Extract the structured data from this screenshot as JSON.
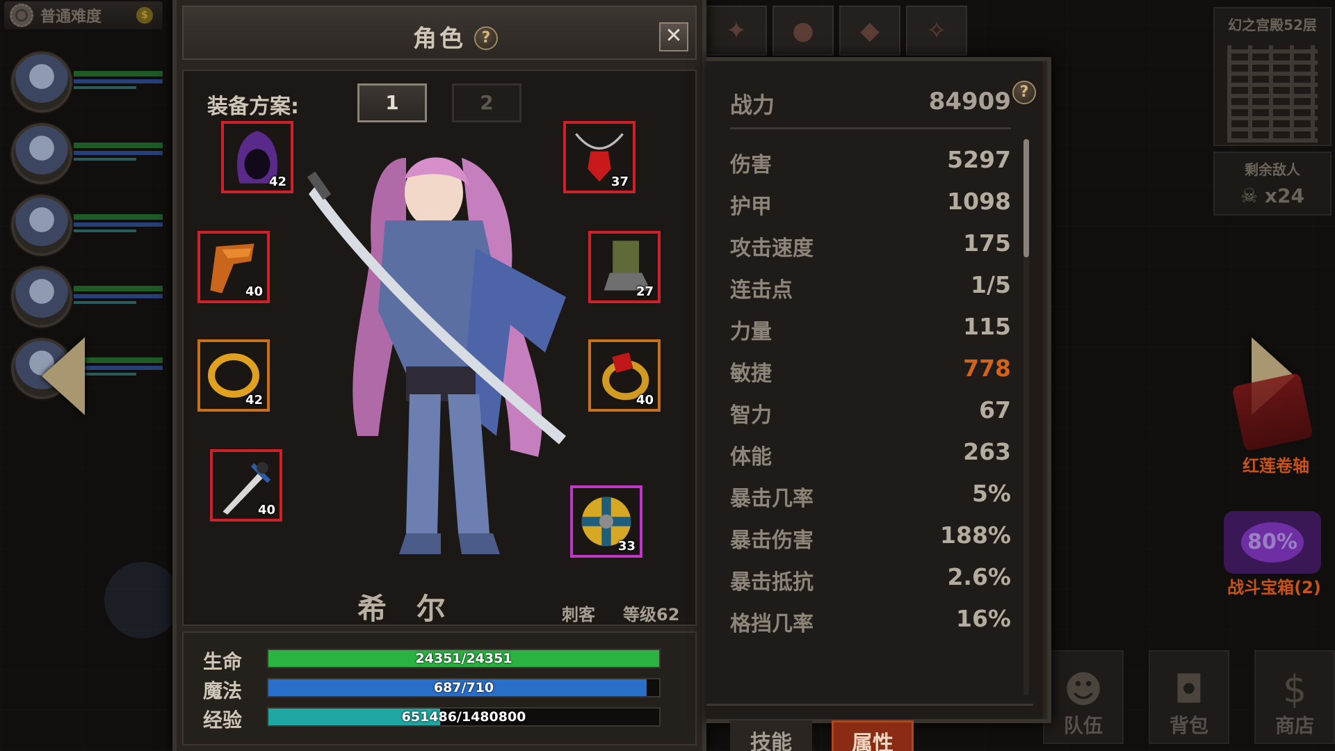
{
  "left_hud": {
    "difficulty": "普通难度"
  },
  "right_hud": {
    "floor_name": "幻之宫殿52层",
    "enemies_title": "剩余敌人",
    "enemies_count": "x24",
    "scroll_label": "红莲卷轴",
    "chest_percent": "80%",
    "chest_label": "战斗宝箱(2)",
    "bottom_buttons": [
      "队伍",
      "背包",
      "商店"
    ]
  },
  "character": {
    "title": "角色",
    "help": "?",
    "close": "✕",
    "equip_set_label": "装备方案:",
    "equip_sets": [
      "1",
      "2"
    ],
    "active_set": "1",
    "name": "希 尔",
    "class": "刺客",
    "level": "等级62",
    "equipment": [
      {
        "slot": "helmet",
        "level": "42",
        "rarity_color": "#d0202a"
      },
      {
        "slot": "necklace",
        "level": "37",
        "rarity_color": "#d0202a"
      },
      {
        "slot": "cloak",
        "level": "40",
        "rarity_color": "#d0202a"
      },
      {
        "slot": "boots",
        "level": "27",
        "rarity_color": "#d0202a"
      },
      {
        "slot": "ring-left",
        "level": "42",
        "rarity_color": "#c9701f"
      },
      {
        "slot": "ring-right",
        "level": "40",
        "rarity_color": "#c9701f"
      },
      {
        "slot": "weapon",
        "level": "40",
        "rarity_color": "#d0202a"
      },
      {
        "slot": "shield",
        "level": "33",
        "rarity_color": "#c136c8"
      }
    ],
    "bars": {
      "hp": {
        "label": "生命",
        "text": "24351/24351",
        "fraction": 1.0,
        "color": "#2bb341"
      },
      "mp": {
        "label": "魔法",
        "text": "687/710",
        "fraction": 0.968,
        "color": "#2a6fc8"
      },
      "xp": {
        "label": "经验",
        "text": "651486/1480800",
        "fraction": 0.44,
        "color": "#1fa7a3"
      }
    }
  },
  "stats": {
    "power_label": "战力",
    "power_value": "84909",
    "help": "?",
    "list": [
      {
        "key": "伤害",
        "value": "5297"
      },
      {
        "key": "护甲",
        "value": "1098"
      },
      {
        "key": "攻击速度",
        "value": "175"
      },
      {
        "key": "连击点",
        "value": "1/5"
      },
      {
        "key": "力量",
        "value": "115"
      },
      {
        "key": "敏捷",
        "value": "778",
        "highlight": true
      },
      {
        "key": "智力",
        "value": "67"
      },
      {
        "key": "体能",
        "value": "263"
      },
      {
        "key": "暴击几率",
        "value": "5%"
      },
      {
        "key": "暴击伤害",
        "value": "188%"
      },
      {
        "key": "暴击抵抗",
        "value": "2.6%"
      },
      {
        "key": "格挡几率",
        "value": "16%"
      }
    ],
    "tabs": {
      "skill": "技能",
      "attr": "属性"
    },
    "active_tab": "属性"
  }
}
